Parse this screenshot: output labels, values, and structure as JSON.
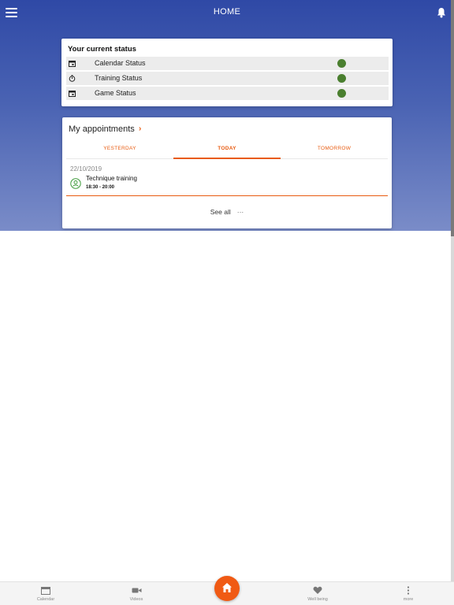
{
  "header": {
    "title": "HOME",
    "menu_icon": "hamburger-menu-icon",
    "notification_icon": "bell-icon"
  },
  "status": {
    "title": "Your current status",
    "rows": [
      {
        "label": "Calendar Status",
        "icon": "calendar-icon",
        "indicator_color": "#4a7f2f"
      },
      {
        "label": "Training Status",
        "icon": "stopwatch-icon",
        "indicator_color": "#4a7f2f"
      },
      {
        "label": "Game Status",
        "icon": "calendar-icon",
        "indicator_color": "#4a7f2f"
      }
    ]
  },
  "appointments": {
    "title": "My appointments",
    "tabs": [
      {
        "label": "YESTERDAY",
        "active": false
      },
      {
        "label": "TODAY",
        "active": true
      },
      {
        "label": "TOMORROW",
        "active": false
      }
    ],
    "items": [
      {
        "date": "22/10/2019",
        "name": "Technique training",
        "time": "18:30 - 20:00",
        "icon": "training-icon"
      }
    ],
    "see_all": "See all",
    "see_all_dots": "···"
  },
  "bottom_nav": {
    "items": [
      {
        "label": "Calendar",
        "icon": "calendar-icon"
      },
      {
        "label": "Videos",
        "icon": "video-camera-icon"
      },
      {
        "label": "Well being",
        "icon": "heart-icon"
      },
      {
        "label": "more",
        "icon": "more-vertical-icon"
      }
    ],
    "home_icon": "home-icon"
  },
  "colors": {
    "accent": "#f05a14",
    "header_top": "#2f49a6",
    "header_bottom": "#7a8cc8",
    "status_ok": "#4a7f2f"
  }
}
